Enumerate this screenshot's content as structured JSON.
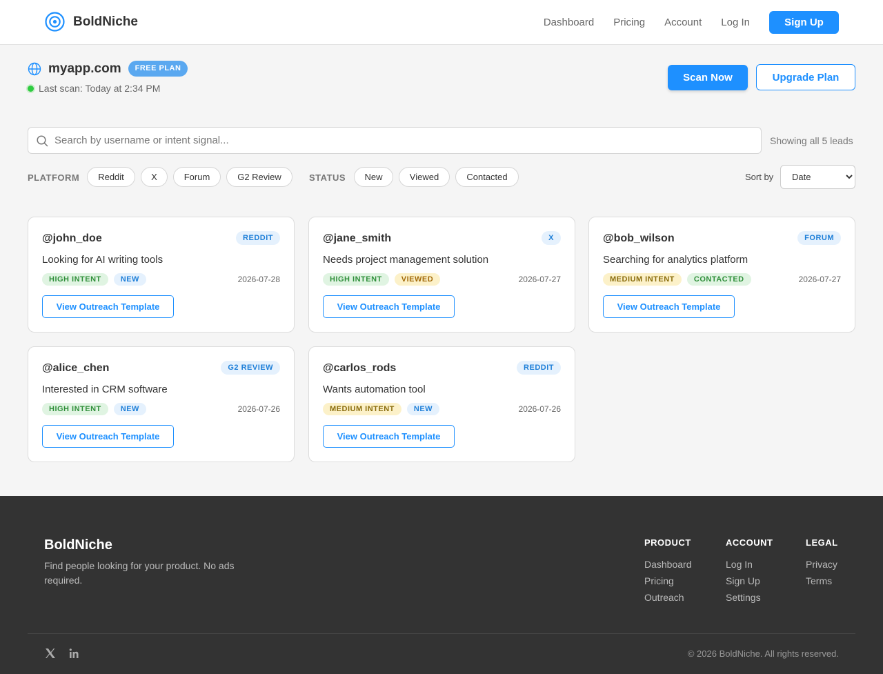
{
  "header": {
    "brand": "BoldNiche",
    "nav": [
      "Dashboard",
      "Pricing",
      "Account",
      "Log In"
    ],
    "signup_label": "Sign Up"
  },
  "site": {
    "domain": "myapp.com",
    "plan": "FREE PLAN",
    "last_scan": "Last scan: Today at 2:34 PM",
    "scan_label": "Scan Now",
    "upgrade_label": "Upgrade Plan"
  },
  "search": {
    "placeholder": "Search by username or intent signal...",
    "value": "",
    "showing": "Showing all 5 leads"
  },
  "filters": {
    "platform_label": "PLATFORM",
    "platforms": [
      "Reddit",
      "X",
      "Forum",
      "G2 Review"
    ],
    "status_label": "STATUS",
    "statuses": [
      "New",
      "Viewed",
      "Contacted"
    ],
    "sort_label": "Sort by",
    "sort_value": "Date"
  },
  "leads": [
    {
      "user": "@john_doe",
      "platform": "REDDIT",
      "signal": "Looking for AI writing tools",
      "intent": "HIGH INTENT",
      "status": "NEW",
      "date": "2026-07-28",
      "action": "View Outreach Template"
    },
    {
      "user": "@jane_smith",
      "platform": "X",
      "signal": "Needs project management solution",
      "intent": "HIGH INTENT",
      "status": "VIEWED",
      "date": "2026-07-27",
      "action": "View Outreach Template"
    },
    {
      "user": "@bob_wilson",
      "platform": "FORUM",
      "signal": "Searching for analytics platform",
      "intent": "MEDIUM INTENT",
      "status": "CONTACTED",
      "date": "2026-07-27",
      "action": "View Outreach Template"
    },
    {
      "user": "@alice_chen",
      "platform": "G2 REVIEW",
      "signal": "Interested in CRM software",
      "intent": "HIGH INTENT",
      "status": "NEW",
      "date": "2026-07-26",
      "action": "View Outreach Template"
    },
    {
      "user": "@carlos_rods",
      "platform": "REDDIT",
      "signal": "Wants automation tool",
      "intent": "MEDIUM INTENT",
      "status": "NEW",
      "date": "2026-07-26",
      "action": "View Outreach Template"
    }
  ],
  "footer": {
    "brand": "BoldNiche",
    "tagline": "Find people looking for your product. No ads required.",
    "columns": [
      {
        "title": "PRODUCT",
        "links": [
          "Dashboard",
          "Pricing",
          "Outreach"
        ]
      },
      {
        "title": "ACCOUNT",
        "links": [
          "Log In",
          "Sign Up",
          "Settings"
        ]
      },
      {
        "title": "LEGAL",
        "links": [
          "Privacy",
          "Terms"
        ]
      }
    ],
    "copyright": "© 2026 BoldNiche. All rights reserved.",
    "social_icons": [
      "x-icon",
      "linkedin-icon"
    ]
  },
  "colors": {
    "accent": "#1e90ff",
    "footer_bg": "#333333",
    "online": "#2ecc40"
  }
}
